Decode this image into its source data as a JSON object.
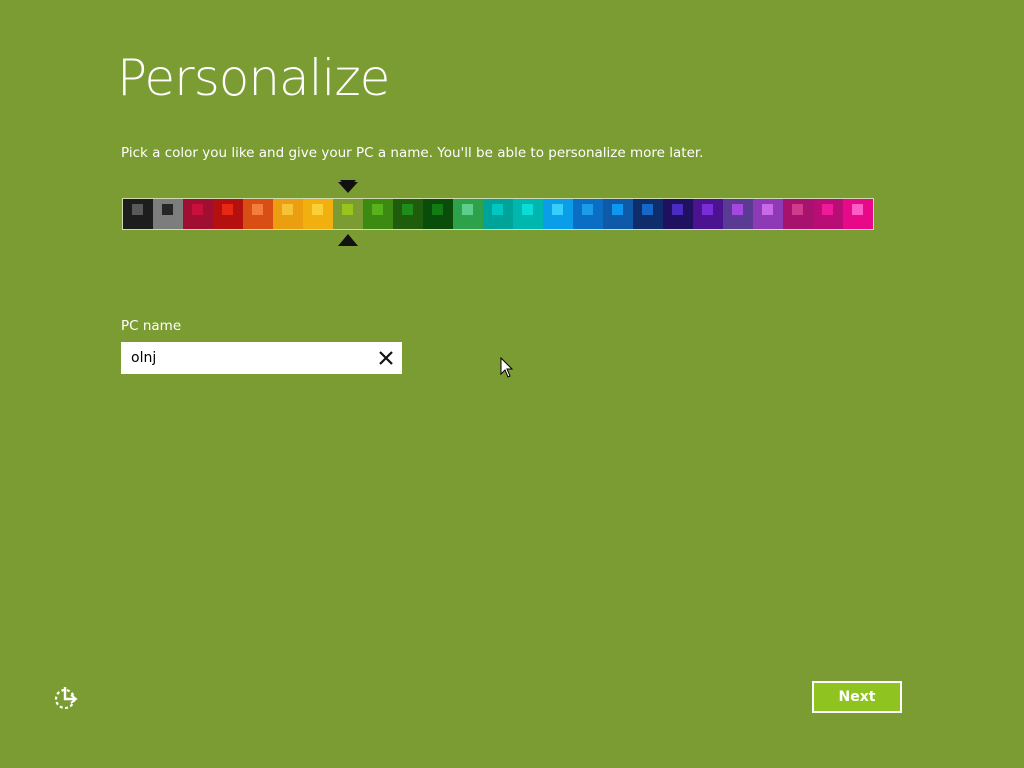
{
  "page": {
    "title": "Personalize",
    "subtitle": "Pick a color you like and give your PC a name. You'll be able to personalize more later.",
    "background_color": "#7a9c32"
  },
  "color_picker": {
    "selected_index": 7,
    "swatches": [
      {
        "base": "#1d1d1d",
        "accent": "#595959"
      },
      {
        "base": "#7d7d7d",
        "accent": "#262626"
      },
      {
        "base": "#a00f32",
        "accent": "#c8103c"
      },
      {
        "base": "#b51010",
        "accent": "#e62814"
      },
      {
        "base": "#d94e13",
        "accent": "#f27d3e"
      },
      {
        "base": "#eb9e0f",
        "accent": "#f5c238"
      },
      {
        "base": "#f2b010",
        "accent": "#fbd036"
      },
      {
        "base": "#7a9c32",
        "accent": "#99c41d"
      },
      {
        "base": "#3c8a12",
        "accent": "#58b21c"
      },
      {
        "base": "#1f5c0c",
        "accent": "#1f8d1b"
      },
      {
        "base": "#0a4d0a",
        "accent": "#137b13"
      },
      {
        "base": "#2ea24a",
        "accent": "#5fce8a"
      },
      {
        "base": "#00a39a",
        "accent": "#00c7c0"
      },
      {
        "base": "#00b7b0",
        "accent": "#0adcd6"
      },
      {
        "base": "#0a9ee8",
        "accent": "#38cdfa"
      },
      {
        "base": "#0a6ec4",
        "accent": "#1c9be8"
      },
      {
        "base": "#0f5aa8",
        "accent": "#0f96f0"
      },
      {
        "base": "#0f2d6a",
        "accent": "#1668c8"
      },
      {
        "base": "#1f1160",
        "accent": "#4a2cc2"
      },
      {
        "base": "#4b1390",
        "accent": "#7a2cd8"
      },
      {
        "base": "#5b3a94",
        "accent": "#a448e0"
      },
      {
        "base": "#8e3ab6",
        "accent": "#c86ae8"
      },
      {
        "base": "#a6126e",
        "accent": "#d23a8c"
      },
      {
        "base": "#b80d74",
        "accent": "#ee1a9a"
      },
      {
        "base": "#e8088a",
        "accent": "#ff5cc8"
      }
    ]
  },
  "pc_name": {
    "label": "PC name",
    "value": "olnj",
    "clear_label": "×"
  },
  "footer": {
    "next_label": "Next",
    "accent_color": "#8fc31f"
  },
  "icons": {
    "clear": "close-icon",
    "ease_of_access": "ease-of-access-icon",
    "cursor": "mouse-pointer-icon"
  }
}
